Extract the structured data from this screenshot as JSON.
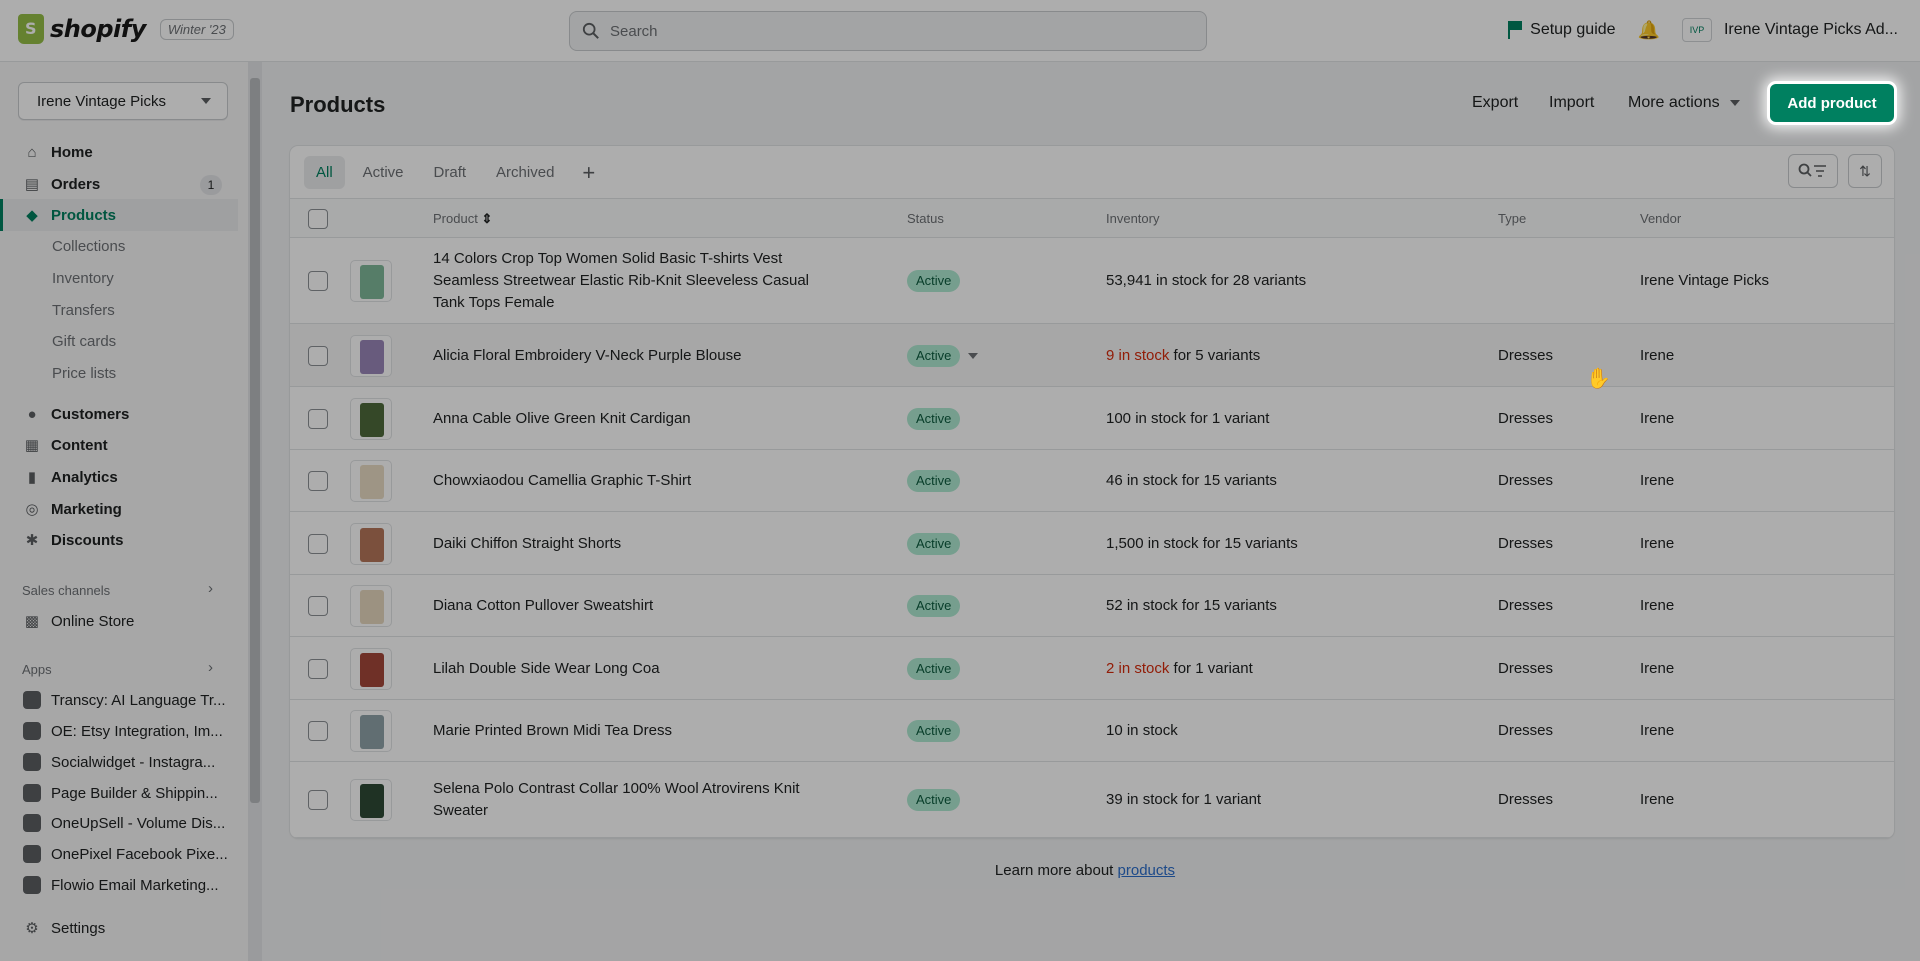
{
  "topbar": {
    "brand": "shopify",
    "edition": "Winter '23",
    "search_placeholder": "Search",
    "setup_guide": "Setup guide",
    "store_account": "Irene Vintage Picks Ad...",
    "avatar_text": "IVP"
  },
  "sidebar": {
    "store_select": "Irene Vintage Picks",
    "nav": [
      {
        "label": "Home",
        "icon": "home-icon"
      },
      {
        "label": "Orders",
        "icon": "orders-icon",
        "badge": "1"
      },
      {
        "label": "Products",
        "icon": "tag-icon"
      }
    ],
    "products_sub": [
      "Collections",
      "Inventory",
      "Transfers",
      "Gift cards",
      "Price lists"
    ],
    "nav2": [
      {
        "label": "Customers",
        "icon": "person-icon"
      },
      {
        "label": "Content",
        "icon": "content-icon"
      },
      {
        "label": "Analytics",
        "icon": "analytics-icon"
      },
      {
        "label": "Marketing",
        "icon": "marketing-icon"
      },
      {
        "label": "Discounts",
        "icon": "discount-icon"
      }
    ],
    "sales_channels_title": "Sales channels",
    "online_store": "Online Store",
    "apps_title": "Apps",
    "apps": [
      "Transcy: AI Language Tr...",
      "OE: Etsy Integration, Im...",
      "Socialwidget - Instagra...",
      "Page Builder & Shippin...",
      "OneUpSell - Volume Dis...",
      "OnePixel Facebook Pixe...",
      "Flowio Email Marketing..."
    ],
    "settings": "Settings"
  },
  "page": {
    "title": "Products",
    "export": "Export",
    "import": "Import",
    "more_actions": "More actions",
    "add_product": "Add product"
  },
  "tabs": [
    "All",
    "Active",
    "Draft",
    "Archived"
  ],
  "table": {
    "headers": {
      "product": "Product",
      "status": "Status",
      "inventory": "Inventory",
      "type": "Type",
      "vendor": "Vendor"
    },
    "rows": [
      {
        "title": "14 Colors Crop Top Women Solid Basic T-shirts Vest Seamless Streetwear Elastic Rib-Knit Sleeveless Casual Tank Tops Female",
        "status": "Active",
        "inv_low": "",
        "inv_text": "53,941 in stock for 28 variants",
        "type": "",
        "vendor": "Irene Vintage Picks",
        "thumb_color": "#7fb89a"
      },
      {
        "title": "Alicia Floral Embroidery V-Neck Purple Blouse",
        "status": "Active",
        "inv_low": "9 in stock",
        "inv_text": " for 5 variants",
        "type": "Dresses",
        "vendor": "Irene",
        "thumb_color": "#9a86b8"
      },
      {
        "title": "Anna Cable Olive Green Knit Cardigan",
        "status": "Active",
        "inv_low": "",
        "inv_text": "100 in stock for 1 variant",
        "type": "Dresses",
        "vendor": "Irene",
        "thumb_color": "#4e6b3c"
      },
      {
        "title": "Chowxiaodou Camellia Graphic T-Shirt",
        "status": "Active",
        "inv_low": "",
        "inv_text": "46 in stock for 15 variants",
        "type": "Dresses",
        "vendor": "Irene",
        "thumb_color": "#e9dcc4"
      },
      {
        "title": "Daiki Chiffon Straight Shorts",
        "status": "Active",
        "inv_low": "",
        "inv_text": "1,500 in stock for 15 variants",
        "type": "Dresses",
        "vendor": "Irene",
        "thumb_color": "#b5765a"
      },
      {
        "title": "Diana Cotton Pullover Sweatshirt",
        "status": "Active",
        "inv_low": "",
        "inv_text": "52 in stock for 15 variants",
        "type": "Dresses",
        "vendor": "Irene",
        "thumb_color": "#e6d8bf"
      },
      {
        "title": "Lilah Double Side Wear Long Coa",
        "status": "Active",
        "inv_low": "2 in stock",
        "inv_text": " for 1 variant",
        "type": "Dresses",
        "vendor": "Irene",
        "thumb_color": "#a4483a"
      },
      {
        "title": "Marie Printed Brown Midi Tea Dress",
        "status": "Active",
        "inv_low": "",
        "inv_text": "10 in stock",
        "type": "Dresses",
        "vendor": "Irene",
        "thumb_color": "#8fa3a8"
      },
      {
        "title": "Selena Polo Contrast Collar 100% Wool Atrovirens Knit Sweater",
        "status": "Active",
        "inv_low": "",
        "inv_text": "39 in stock for 1 variant",
        "type": "Dresses",
        "vendor": "Irene",
        "thumb_color": "#2f4a35"
      }
    ]
  },
  "footer": {
    "text": "Learn more about",
    "link": "products"
  }
}
